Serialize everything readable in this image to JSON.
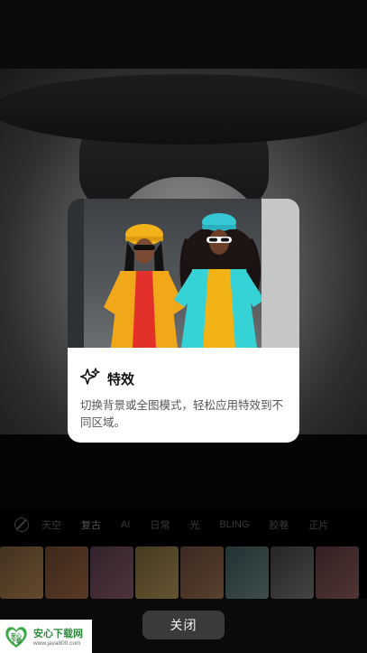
{
  "dialog": {
    "title": "特效",
    "description": "切换背景或全图模式，轻松应用特效到不同区域。",
    "icon": "sparkles-icon"
  },
  "filter_tabs": [
    {
      "label": "天空"
    },
    {
      "label": "复古"
    },
    {
      "label": "AI"
    },
    {
      "label": "日常"
    },
    {
      "label": "光"
    },
    {
      "label": "BLING"
    },
    {
      "label": "胶卷"
    },
    {
      "label": "正片"
    }
  ],
  "close_button": {
    "label": "关闭"
  },
  "watermark": {
    "title": "安心下载网",
    "url": "www.java800.com",
    "badge": "安心\n下载"
  },
  "colors": {
    "accent_yellow": "#f2b316",
    "accent_cyan": "#35d3d6",
    "button_bg": "#3a3a3a",
    "watermark_green": "#2e8b3a"
  }
}
